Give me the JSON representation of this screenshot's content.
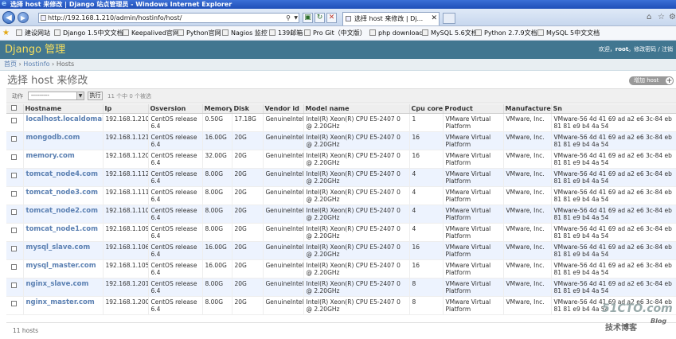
{
  "window": {
    "title": "选择 host 来修改 | Django 站点管理员 - Windows Internet Explorer"
  },
  "browser": {
    "url": "http://192.168.1.210/admin/hostinfo/host/",
    "tab_title": "选择 host 来修改 | Dj...",
    "favorites": [
      "建设网站",
      "Django 1.5中文文档",
      "Keepalived官网",
      "Python官网",
      "Nagios 监控",
      "139邮箱",
      "Pro Git（中文版）",
      "php downloads",
      "MySQL 5.6文档",
      "Python 2.7.9文档",
      "MySQL 5中文文档"
    ]
  },
  "header": {
    "site_name": "Django 管理",
    "welcome": "欢迎，",
    "user": "root",
    "links": "。修改密码 / 注销"
  },
  "breadcrumbs": {
    "home": "首页",
    "app": "Hostinfo",
    "current": "Hosts"
  },
  "page": {
    "title": "选择 host 来修改",
    "add_button": "增加 host"
  },
  "actions": {
    "label": "动作",
    "select_value": "---------",
    "go_button": "执行",
    "selected_count": "11 个中 0 个被选"
  },
  "table": {
    "columns": [
      "Hostname",
      "Ip",
      "Osversion",
      "Memory",
      "Disk",
      "Vendor id",
      "Model name",
      "Cpu core",
      "Product",
      "Manufacturer",
      "Sn"
    ],
    "rows": [
      {
        "hostname": "localhost.localdomain",
        "ip": "192.168.1.210",
        "os": "CentOS release 6.4",
        "memory": "0.50G",
        "disk": "17.18G",
        "vendor": "GenuineIntel",
        "model": "Intel(R) Xeon(R) CPU E5-2407 0 @ 2.20GHz",
        "cpu": "1",
        "product": "VMware Virtual Platform",
        "manufacturer": "VMware, Inc.",
        "sn": "VMware-56 4d 41 69 ad a2 e6 3c-84 eb 81 81 e9 b4 4a 54"
      },
      {
        "hostname": "mongodb.com",
        "ip": "192.168.1.121",
        "os": "CentOS release 6.4",
        "memory": "16.00G",
        "disk": "20G",
        "vendor": "GenuineIntel",
        "model": "Intel(R) Xeon(R) CPU E5-2407 0 @ 2.20GHz",
        "cpu": "16",
        "product": "VMware Virtual Platform",
        "manufacturer": "VMware, Inc.",
        "sn": "VMware-56 4d 41 69 ad a2 e6 3c-84 eb 81 81 e9 b4 4a 54"
      },
      {
        "hostname": "memory.com",
        "ip": "192.168.1.120",
        "os": "CentOS release 6.4",
        "memory": "32.00G",
        "disk": "20G",
        "vendor": "GenuineIntel",
        "model": "Intel(R) Xeon(R) CPU E5-2407 0 @ 2.20GHz",
        "cpu": "16",
        "product": "VMware Virtual Platform",
        "manufacturer": "VMware, Inc.",
        "sn": "VMware-56 4d 41 69 ad a2 e6 3c-84 eb 81 81 e9 b4 4a 54"
      },
      {
        "hostname": "tomcat_node4.com",
        "ip": "192.168.1.112",
        "os": "CentOS release 6.4",
        "memory": "8.00G",
        "disk": "20G",
        "vendor": "GenuineIntel",
        "model": "Intel(R) Xeon(R) CPU E5-2407 0 @ 2.20GHz",
        "cpu": "4",
        "product": "VMware Virtual Platform",
        "manufacturer": "VMware, Inc.",
        "sn": "VMware-56 4d 41 69 ad a2 e6 3c-84 eb 81 81 e9 b4 4a 54"
      },
      {
        "hostname": "tomcat_node3.com",
        "ip": "192.168.1.111",
        "os": "CentOS release 6.4",
        "memory": "8.00G",
        "disk": "20G",
        "vendor": "GenuineIntel",
        "model": "Intel(R) Xeon(R) CPU E5-2407 0 @ 2.20GHz",
        "cpu": "4",
        "product": "VMware Virtual Platform",
        "manufacturer": "VMware, Inc.",
        "sn": "VMware-56 4d 41 69 ad a2 e6 3c-84 eb 81 81 e9 b4 4a 54"
      },
      {
        "hostname": "tomcat_node2.com",
        "ip": "192.168.1.110",
        "os": "CentOS release 6.4",
        "memory": "8.00G",
        "disk": "20G",
        "vendor": "GenuineIntel",
        "model": "Intel(R) Xeon(R) CPU E5-2407 0 @ 2.20GHz",
        "cpu": "4",
        "product": "VMware Virtual Platform",
        "manufacturer": "VMware, Inc.",
        "sn": "VMware-56 4d 41 69 ad a2 e6 3c-84 eb 81 81 e9 b4 4a 54"
      },
      {
        "hostname": "tomcat_node1.com",
        "ip": "192.168.1.109",
        "os": "CentOS release 6.4",
        "memory": "8.00G",
        "disk": "20G",
        "vendor": "GenuineIntel",
        "model": "Intel(R) Xeon(R) CPU E5-2407 0 @ 2.20GHz",
        "cpu": "4",
        "product": "VMware Virtual Platform",
        "manufacturer": "VMware, Inc.",
        "sn": "VMware-56 4d 41 69 ad a2 e6 3c-84 eb 81 81 e9 b4 4a 54"
      },
      {
        "hostname": "mysql_slave.com",
        "ip": "192.168.1.106",
        "os": "CentOS release 6.4",
        "memory": "16.00G",
        "disk": "20G",
        "vendor": "GenuineIntel",
        "model": "Intel(R) Xeon(R) CPU E5-2407 0 @ 2.20GHz",
        "cpu": "16",
        "product": "VMware Virtual Platform",
        "manufacturer": "VMware, Inc.",
        "sn": "VMware-56 4d 41 69 ad a2 e6 3c-84 eb 81 81 e9 b4 4a 54"
      },
      {
        "hostname": "mysql_master.com",
        "ip": "192.168.1.105",
        "os": "CentOS release 6.4",
        "memory": "16.00G",
        "disk": "20G",
        "vendor": "GenuineIntel",
        "model": "Intel(R) Xeon(R) CPU E5-2407 0 @ 2.20GHz",
        "cpu": "16",
        "product": "VMware Virtual Platform",
        "manufacturer": "VMware, Inc.",
        "sn": "VMware-56 4d 41 69 ad a2 e6 3c-84 eb 81 81 e9 b4 4a 54"
      },
      {
        "hostname": "nginx_slave.com",
        "ip": "192.168.1.201",
        "os": "CentOS release 6.4",
        "memory": "8.00G",
        "disk": "20G",
        "vendor": "GenuineIntel",
        "model": "Intel(R) Xeon(R) CPU E5-2407 0 @ 2.20GHz",
        "cpu": "8",
        "product": "VMware Virtual Platform",
        "manufacturer": "VMware, Inc.",
        "sn": "VMware-56 4d 41 69 ad a2 e6 3c-84 eb 81 81 e9 b4 4a 54"
      },
      {
        "hostname": "nginx_master.com",
        "ip": "192.168.1.200",
        "os": "CentOS release 6.4",
        "memory": "8.00G",
        "disk": "20G",
        "vendor": "GenuineIntel",
        "model": "Intel(R) Xeon(R) CPU E5-2407 0 @ 2.20GHz",
        "cpu": "8",
        "product": "VMware Virtual Platform",
        "manufacturer": "VMware, Inc.",
        "sn": "VMware-56 4d 41 69 ad a2 e6 3c-84 eb 81 81 e9 b4 4a 54"
      }
    ]
  },
  "paginator": {
    "count": "11 hosts"
  },
  "watermark": {
    "site": "51CTO.com",
    "sub": "技术博客",
    "blog": "Blog"
  },
  "colors": {
    "header_bg": "#417690",
    "site_name": "#f5dd5d",
    "link": "#5b80b2",
    "row_alt": "#edf3fe",
    "highlight_border": "#d9534f"
  },
  "icons": {
    "back": "back-arrow-icon",
    "forward": "forward-arrow-icon",
    "search": "search-icon",
    "refresh": "refresh-icon",
    "stop": "stop-icon",
    "home": "home-icon",
    "favorites": "star-icon",
    "settings": "gear-icon"
  }
}
